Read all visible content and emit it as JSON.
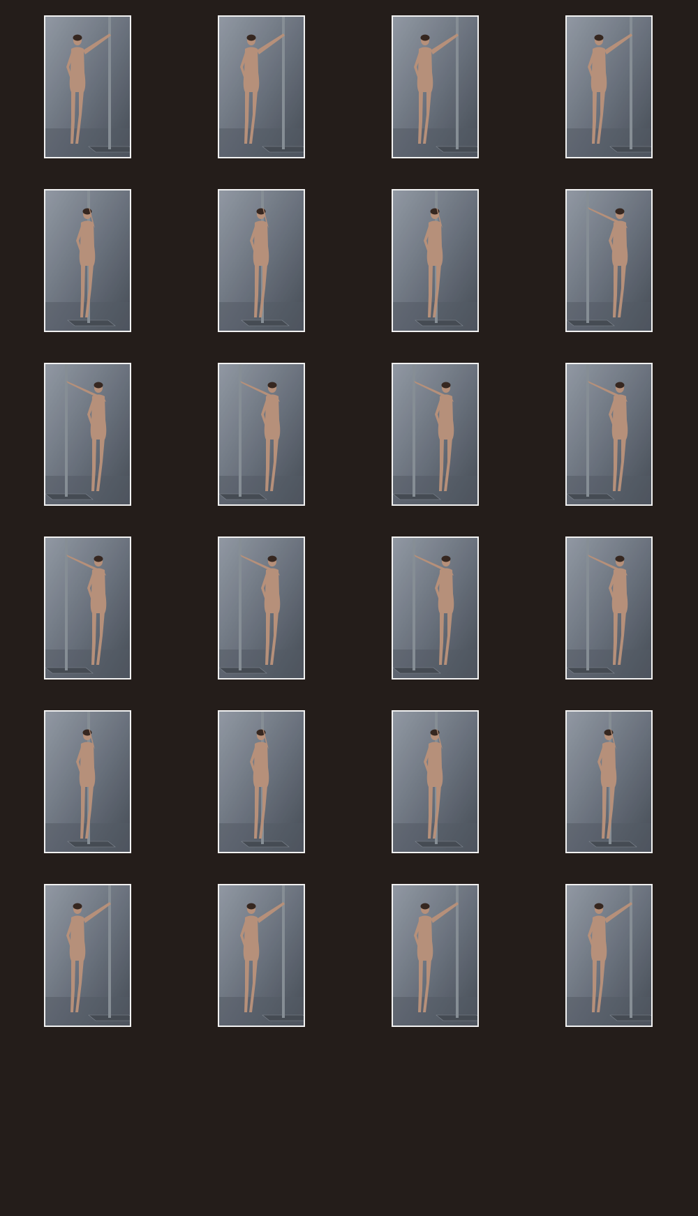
{
  "sheet": {
    "background_color": "#241d1a",
    "frame_color": "#f2f2f2",
    "backdrop_color": "#6c7480",
    "rows": 6,
    "columns": 4
  },
  "thumbnails": [
    {
      "pose": "front",
      "pole": "right"
    },
    {
      "pose": "front",
      "pole": "right"
    },
    {
      "pose": "front-right",
      "pole": "right"
    },
    {
      "pose": "three-quarter-right",
      "pole": "right"
    },
    {
      "pose": "side-right",
      "pole": "center"
    },
    {
      "pose": "side-right",
      "pole": "center"
    },
    {
      "pose": "side-right",
      "pole": "center"
    },
    {
      "pose": "back-right",
      "pole": "left"
    },
    {
      "pose": "back",
      "pole": "left"
    },
    {
      "pose": "back",
      "pole": "left"
    },
    {
      "pose": "back",
      "pole": "left"
    },
    {
      "pose": "back",
      "pole": "left"
    },
    {
      "pose": "back",
      "pole": "left"
    },
    {
      "pose": "back",
      "pole": "left"
    },
    {
      "pose": "back-left",
      "pole": "left"
    },
    {
      "pose": "back-left",
      "pole": "left"
    },
    {
      "pose": "side-left",
      "pole": "center"
    },
    {
      "pose": "side-left",
      "pole": "center"
    },
    {
      "pose": "side-left",
      "pole": "center"
    },
    {
      "pose": "three-quarter-left",
      "pole": "center"
    },
    {
      "pose": "front",
      "pole": "right"
    },
    {
      "pose": "front",
      "pole": "right"
    },
    {
      "pose": "front",
      "pole": "right"
    },
    {
      "pose": "front",
      "pole": "right"
    }
  ]
}
